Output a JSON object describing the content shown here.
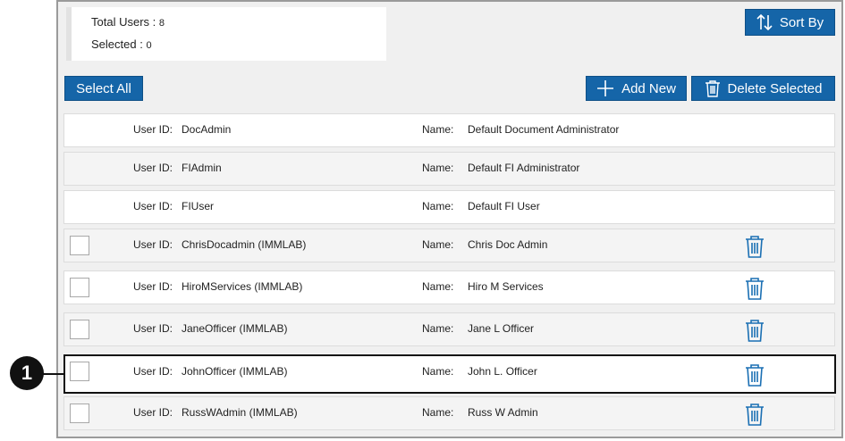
{
  "summary": {
    "total_label": "Total Users : ",
    "total_value": "8",
    "selected_label": "Selected : ",
    "selected_value": "0"
  },
  "toolbar": {
    "sort_label": "Sort By",
    "select_all_label": "Select All",
    "add_new_label": "Add New",
    "delete_selected_label": "Delete Selected"
  },
  "row_labels": {
    "user_id": "User ID:",
    "name": "Name:"
  },
  "users": [
    {
      "user_id": "DocAdmin",
      "name": "Default Document Administrator"
    },
    {
      "user_id": "FIAdmin",
      "name": "Default FI Administrator"
    },
    {
      "user_id": "FIUser",
      "name": "Default FI User"
    },
    {
      "user_id": "ChrisDocadmin (IMMLAB)",
      "name": "Chris Doc Admin"
    },
    {
      "user_id": "HiroMServices (IMMLAB)",
      "name": "Hiro M Services"
    },
    {
      "user_id": "JaneOfficer (IMMLAB)",
      "name": "Jane L Officer"
    },
    {
      "user_id": "JohnOfficer (IMMLAB)",
      "name": "John L. Officer"
    },
    {
      "user_id": "RussWAdmin (IMMLAB)",
      "name": "Russ W Admin"
    }
  ],
  "callout": {
    "number": "1"
  },
  "colors": {
    "accent": "#1565a8",
    "trash": "#1a6fb3",
    "highlight_border": "#111111"
  },
  "icons": {
    "sort": "sort-arrows-icon",
    "add": "plus-icon",
    "delete": "trash-icon"
  }
}
